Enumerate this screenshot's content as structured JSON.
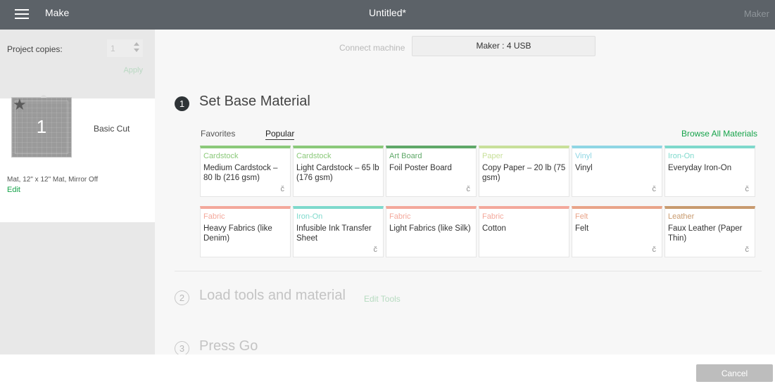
{
  "header": {
    "mode_label": "Make",
    "doc_title": "Untitled*",
    "machine_label": "Maker"
  },
  "left_panel": {
    "copies_label": "Project copies:",
    "copies_value": "1",
    "apply_label": "Apply",
    "mat": {
      "number": "1",
      "title": "Basic Cut",
      "details": "Mat, 12\" x 12\" Mat, Mirror Off",
      "edit_label": "Edit"
    }
  },
  "connect": {
    "label": "Connect machine",
    "button_label": "Maker : 4 USB"
  },
  "steps": [
    {
      "number": "1",
      "title": "Set Base Material"
    },
    {
      "number": "2",
      "title": "Load tools and material"
    },
    {
      "number": "3",
      "title": "Press Go"
    }
  ],
  "edit_tools_label": "Edit Tools",
  "tabs": {
    "favorites": "Favorites",
    "popular": "Popular"
  },
  "browse_label": "Browse All Materials",
  "materials": [
    {
      "category": "Cardstock",
      "name": "Medium Cardstock – 80 lb (216 gsm)",
      "color": "#8bc97a",
      "icon": true
    },
    {
      "category": "Cardstock",
      "name": "Light Cardstock – 65 lb (176 gsm)",
      "color": "#8bc97a",
      "icon": false
    },
    {
      "category": "Art Board",
      "name": "Foil Poster Board",
      "color": "#5fa868",
      "icon": true
    },
    {
      "category": "Paper",
      "name": "Copy Paper – 20 lb (75 gsm)",
      "color": "#c8e09a",
      "icon": false
    },
    {
      "category": "Vinyl",
      "name": "Vinyl",
      "color": "#8fd6e4",
      "icon": true
    },
    {
      "category": "Iron-On",
      "name": "Everyday Iron-On",
      "color": "#7ed9cc",
      "icon": true
    },
    {
      "category": "Fabric",
      "name": "Heavy Fabrics (like Denim)",
      "color": "#f3a89b",
      "icon": false
    },
    {
      "category": "Iron-On",
      "name": "Infusible Ink Transfer Sheet",
      "color": "#7ed9cc",
      "icon": true
    },
    {
      "category": "Fabric",
      "name": "Light Fabrics (like Silk)",
      "color": "#f3a89b",
      "icon": false
    },
    {
      "category": "Fabric",
      "name": "Cotton",
      "color": "#f3a89b",
      "icon": false
    },
    {
      "category": "Felt",
      "name": "Felt",
      "color": "#e9a489",
      "icon": true
    },
    {
      "category": "Leather",
      "name": "Faux Leather (Paper Thin)",
      "color": "#c89a6e",
      "icon": true
    }
  ],
  "card_icon_glyph": "č",
  "cancel_label": "Cancel"
}
